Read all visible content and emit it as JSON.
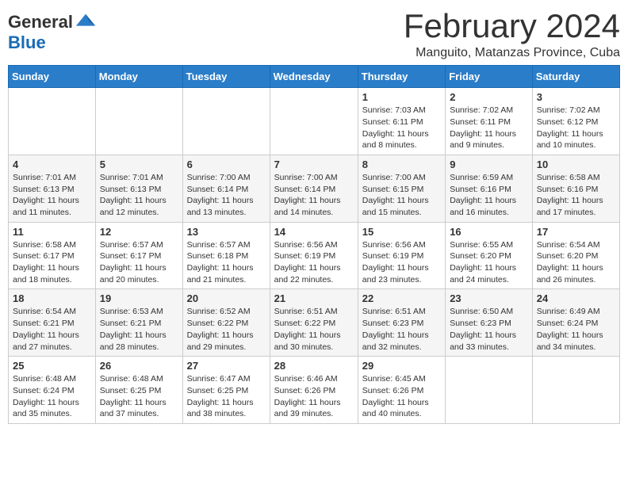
{
  "header": {
    "logo_general": "General",
    "logo_blue": "Blue",
    "title": "February 2024",
    "subtitle": "Manguito, Matanzas Province, Cuba"
  },
  "days_of_week": [
    "Sunday",
    "Monday",
    "Tuesday",
    "Wednesday",
    "Thursday",
    "Friday",
    "Saturday"
  ],
  "weeks": [
    [
      {
        "day": "",
        "info": ""
      },
      {
        "day": "",
        "info": ""
      },
      {
        "day": "",
        "info": ""
      },
      {
        "day": "",
        "info": ""
      },
      {
        "day": "1",
        "info": "Sunrise: 7:03 AM\nSunset: 6:11 PM\nDaylight: 11 hours and 8 minutes."
      },
      {
        "day": "2",
        "info": "Sunrise: 7:02 AM\nSunset: 6:11 PM\nDaylight: 11 hours and 9 minutes."
      },
      {
        "day": "3",
        "info": "Sunrise: 7:02 AM\nSunset: 6:12 PM\nDaylight: 11 hours and 10 minutes."
      }
    ],
    [
      {
        "day": "4",
        "info": "Sunrise: 7:01 AM\nSunset: 6:13 PM\nDaylight: 11 hours and 11 minutes."
      },
      {
        "day": "5",
        "info": "Sunrise: 7:01 AM\nSunset: 6:13 PM\nDaylight: 11 hours and 12 minutes."
      },
      {
        "day": "6",
        "info": "Sunrise: 7:00 AM\nSunset: 6:14 PM\nDaylight: 11 hours and 13 minutes."
      },
      {
        "day": "7",
        "info": "Sunrise: 7:00 AM\nSunset: 6:14 PM\nDaylight: 11 hours and 14 minutes."
      },
      {
        "day": "8",
        "info": "Sunrise: 7:00 AM\nSunset: 6:15 PM\nDaylight: 11 hours and 15 minutes."
      },
      {
        "day": "9",
        "info": "Sunrise: 6:59 AM\nSunset: 6:16 PM\nDaylight: 11 hours and 16 minutes."
      },
      {
        "day": "10",
        "info": "Sunrise: 6:58 AM\nSunset: 6:16 PM\nDaylight: 11 hours and 17 minutes."
      }
    ],
    [
      {
        "day": "11",
        "info": "Sunrise: 6:58 AM\nSunset: 6:17 PM\nDaylight: 11 hours and 18 minutes."
      },
      {
        "day": "12",
        "info": "Sunrise: 6:57 AM\nSunset: 6:17 PM\nDaylight: 11 hours and 20 minutes."
      },
      {
        "day": "13",
        "info": "Sunrise: 6:57 AM\nSunset: 6:18 PM\nDaylight: 11 hours and 21 minutes."
      },
      {
        "day": "14",
        "info": "Sunrise: 6:56 AM\nSunset: 6:19 PM\nDaylight: 11 hours and 22 minutes."
      },
      {
        "day": "15",
        "info": "Sunrise: 6:56 AM\nSunset: 6:19 PM\nDaylight: 11 hours and 23 minutes."
      },
      {
        "day": "16",
        "info": "Sunrise: 6:55 AM\nSunset: 6:20 PM\nDaylight: 11 hours and 24 minutes."
      },
      {
        "day": "17",
        "info": "Sunrise: 6:54 AM\nSunset: 6:20 PM\nDaylight: 11 hours and 26 minutes."
      }
    ],
    [
      {
        "day": "18",
        "info": "Sunrise: 6:54 AM\nSunset: 6:21 PM\nDaylight: 11 hours and 27 minutes."
      },
      {
        "day": "19",
        "info": "Sunrise: 6:53 AM\nSunset: 6:21 PM\nDaylight: 11 hours and 28 minutes."
      },
      {
        "day": "20",
        "info": "Sunrise: 6:52 AM\nSunset: 6:22 PM\nDaylight: 11 hours and 29 minutes."
      },
      {
        "day": "21",
        "info": "Sunrise: 6:51 AM\nSunset: 6:22 PM\nDaylight: 11 hours and 30 minutes."
      },
      {
        "day": "22",
        "info": "Sunrise: 6:51 AM\nSunset: 6:23 PM\nDaylight: 11 hours and 32 minutes."
      },
      {
        "day": "23",
        "info": "Sunrise: 6:50 AM\nSunset: 6:23 PM\nDaylight: 11 hours and 33 minutes."
      },
      {
        "day": "24",
        "info": "Sunrise: 6:49 AM\nSunset: 6:24 PM\nDaylight: 11 hours and 34 minutes."
      }
    ],
    [
      {
        "day": "25",
        "info": "Sunrise: 6:48 AM\nSunset: 6:24 PM\nDaylight: 11 hours and 35 minutes."
      },
      {
        "day": "26",
        "info": "Sunrise: 6:48 AM\nSunset: 6:25 PM\nDaylight: 11 hours and 37 minutes."
      },
      {
        "day": "27",
        "info": "Sunrise: 6:47 AM\nSunset: 6:25 PM\nDaylight: 11 hours and 38 minutes."
      },
      {
        "day": "28",
        "info": "Sunrise: 6:46 AM\nSunset: 6:26 PM\nDaylight: 11 hours and 39 minutes."
      },
      {
        "day": "29",
        "info": "Sunrise: 6:45 AM\nSunset: 6:26 PM\nDaylight: 11 hours and 40 minutes."
      },
      {
        "day": "",
        "info": ""
      },
      {
        "day": "",
        "info": ""
      }
    ]
  ]
}
